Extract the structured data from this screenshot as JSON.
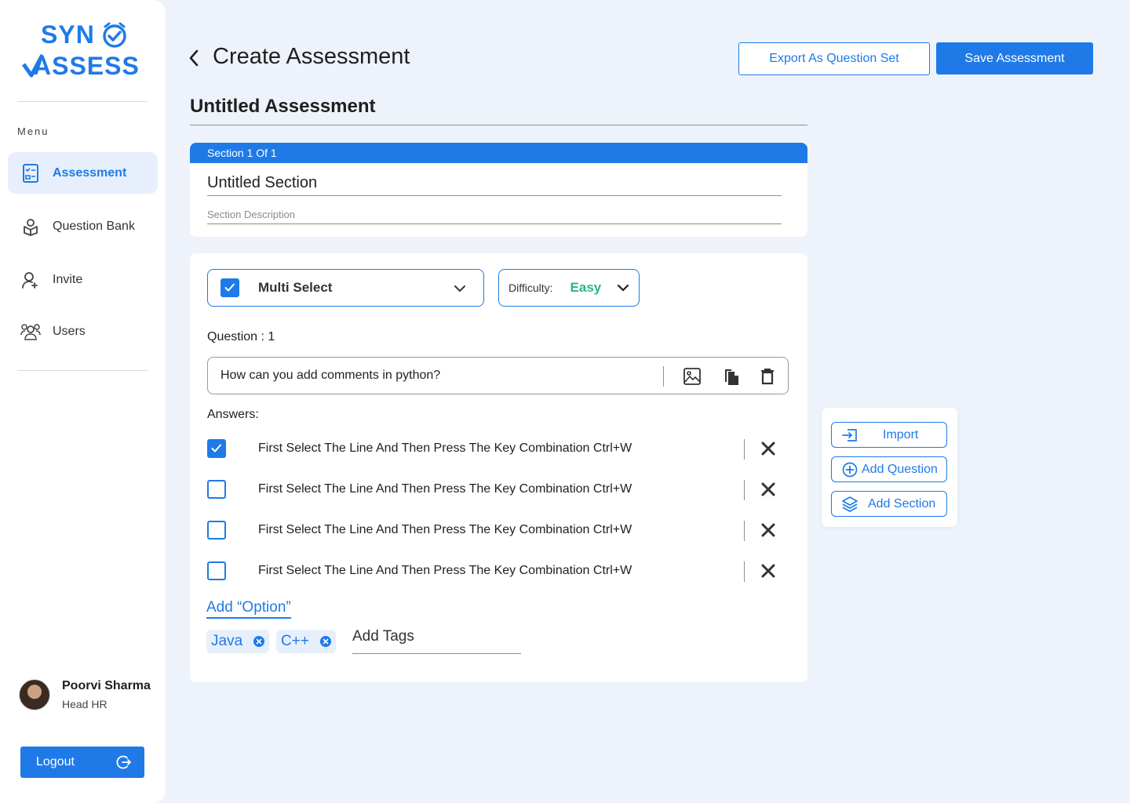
{
  "brand": {
    "line1": "SYN",
    "line2": "ASSESS",
    "color": "#1f7ae8"
  },
  "sidebar": {
    "menu_label": "Menu",
    "items": [
      {
        "label": "Assessment",
        "icon": "checklist-icon",
        "active": true
      },
      {
        "label": "Question Bank",
        "icon": "question-bank-icon",
        "active": false
      },
      {
        "label": "Invite",
        "icon": "user-add-icon",
        "active": false
      },
      {
        "label": "Users",
        "icon": "users-icon",
        "active": false
      }
    ]
  },
  "profile": {
    "name": "Poorvi Sharma",
    "role": "Head HR"
  },
  "logout_label": "Logout",
  "header": {
    "title": "Create Assessment",
    "export_label": "Export As Question Set",
    "save_label": "Save Assessment"
  },
  "assessment_title": "Untitled Assessment",
  "section": {
    "indicator": "Section 1 Of 1",
    "name": "Untitled Section",
    "description_placeholder": "Section Description"
  },
  "question": {
    "type": "Multi Select",
    "difficulty_label": "Difficulty:",
    "difficulty_value": "Easy",
    "number_label": "Question : 1",
    "text": "How can you add comments in python?",
    "answers_label": "Answers:",
    "answers": [
      {
        "text": "First Select The Line And Then Press The Key Combination Ctrl+W",
        "checked": true
      },
      {
        "text": "First Select The Line And Then Press The Key Combination Ctrl+W",
        "checked": false
      },
      {
        "text": "First Select The Line And Then Press The Key Combination Ctrl+W",
        "checked": false
      },
      {
        "text": "First Select The Line And Then Press The Key Combination Ctrl+W",
        "checked": false
      }
    ],
    "add_option_label": "Add “Option”",
    "tags": [
      "Java",
      "C++"
    ],
    "tags_placeholder": "Add Tags"
  },
  "actions": {
    "import_label": "Import",
    "add_question_label": "Add Question",
    "add_section_label": "Add Section"
  },
  "colors": {
    "accent": "#1f7ae8",
    "easy": "#2eb67d",
    "background": "#eef3fb"
  }
}
